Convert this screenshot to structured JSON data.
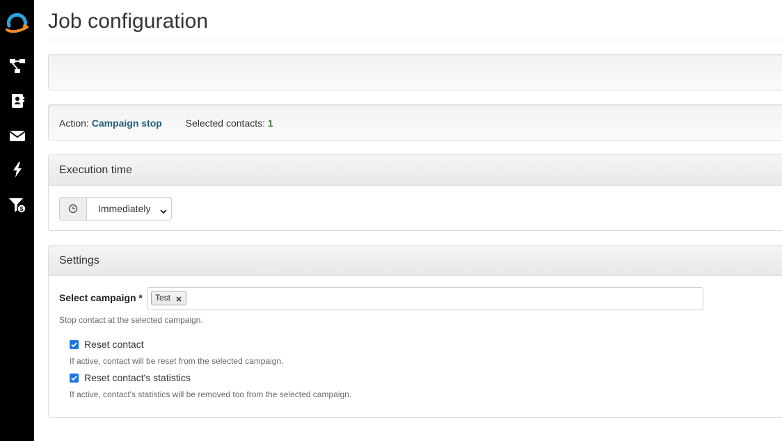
{
  "page": {
    "title": "Job configuration"
  },
  "sidebar": {
    "logo_icon": "loop-arrow-logo",
    "accent_blue": "#2aa5e0",
    "accent_orange": "#f08a24",
    "items": [
      {
        "icon": "flow-chart-icon"
      },
      {
        "icon": "contacts-icon"
      },
      {
        "icon": "envelope-icon"
      },
      {
        "icon": "lightning-icon"
      },
      {
        "icon": "funnel-dollar-icon"
      }
    ]
  },
  "action_bar": {
    "action_label": "Action:",
    "action_value": "Campaign stop",
    "contacts_label": "Selected contacts:",
    "contacts_value": "1"
  },
  "execution": {
    "heading": "Execution time",
    "clock_icon": "clock-icon",
    "selected_option": "Immediately"
  },
  "settings": {
    "heading": "Settings",
    "campaign_label": "Select campaign *",
    "selected_tags": [
      "Test"
    ],
    "campaign_help": "Stop contact at the selected campaign.",
    "reset_contact_label": "Reset contact",
    "reset_contact_checked": true,
    "reset_contact_help": "If active, contact will be reset from the selected campaign.",
    "reset_stats_label": "Reset contact's statistics",
    "reset_stats_checked": true,
    "reset_stats_help": "If active, contact's statistics will be removed too from the selected campaign."
  }
}
